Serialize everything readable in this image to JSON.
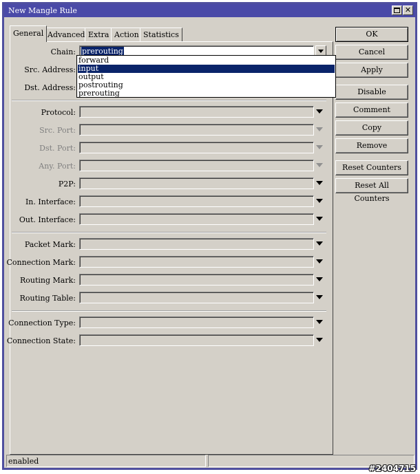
{
  "window": {
    "title": "New Mangle Rule"
  },
  "tabs": [
    {
      "label": "General"
    },
    {
      "label": "Advanced"
    },
    {
      "label": "Extra"
    },
    {
      "label": "Action"
    },
    {
      "label": "Statistics"
    }
  ],
  "fields": {
    "chain": {
      "label": "Chain:",
      "value": "prerouting"
    },
    "src_address": {
      "label": "Src. Address:"
    },
    "dst_address": {
      "label": "Dst. Address:"
    },
    "protocol": {
      "label": "Protocol:"
    },
    "src_port": {
      "label": "Src. Port:"
    },
    "dst_port": {
      "label": "Dst. Port:"
    },
    "any_port": {
      "label": "Any. Port:"
    },
    "p2p": {
      "label": "P2P:"
    },
    "in_interface": {
      "label": "In. Interface:"
    },
    "out_interface": {
      "label": "Out. Interface:"
    },
    "packet_mark": {
      "label": "Packet Mark:"
    },
    "connection_mark": {
      "label": "Connection Mark:"
    },
    "routing_mark": {
      "label": "Routing Mark:"
    },
    "routing_table": {
      "label": "Routing Table:"
    },
    "connection_type": {
      "label": "Connection Type:"
    },
    "connection_state": {
      "label": "Connection State:"
    }
  },
  "chain_dropdown": {
    "options": [
      "forward",
      "input",
      "output",
      "postrouting",
      "prerouting"
    ],
    "highlighted": "input"
  },
  "buttons": {
    "ok": "OK",
    "cancel": "Cancel",
    "apply": "Apply",
    "disable": "Disable",
    "comment": "Comment",
    "copy": "Copy",
    "remove": "Remove",
    "reset_counters": "Reset Counters",
    "reset_all_counters": "Reset All Counters"
  },
  "status": {
    "left": "enabled",
    "right": ""
  },
  "watermark": "#2404715",
  "colors": {
    "titlebar": "#4a4aa8",
    "window_bg": "#d4d0c8",
    "selection": "#0a246a"
  }
}
